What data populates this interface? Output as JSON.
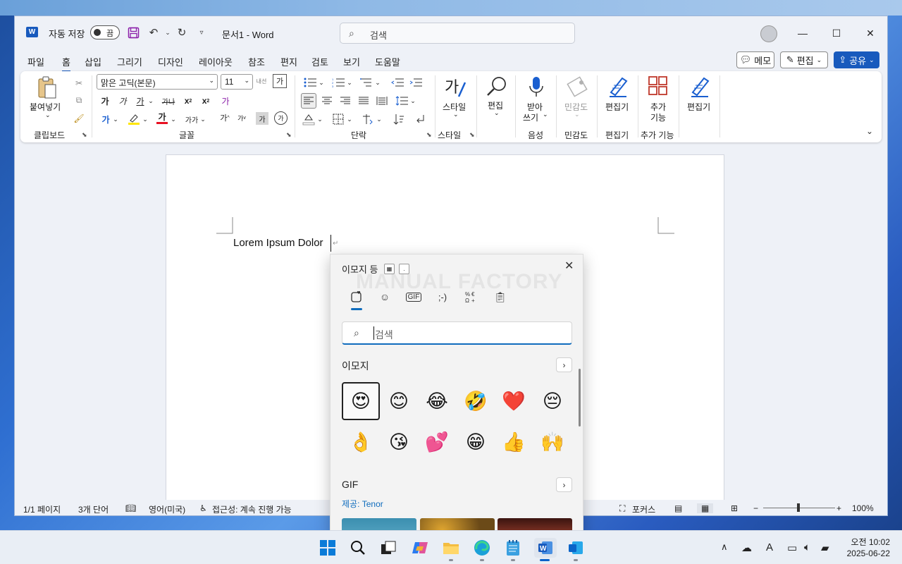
{
  "titlebar": {
    "app_badge": "W",
    "autosave_label": "자동 저장",
    "autosave_state": "끔",
    "doc_title": "문서1  -  Word",
    "search_placeholder": "검색"
  },
  "menu": {
    "tabs": [
      "파일",
      "홈",
      "삽입",
      "그리기",
      "디자인",
      "레이아웃",
      "참조",
      "편지",
      "검토",
      "보기",
      "도움말"
    ],
    "active_tab": "홈",
    "memo_label": "메모",
    "edit_label": "편집",
    "share_label": "공유"
  },
  "ribbon": {
    "clipboard": {
      "paste_label": "붙여넣기",
      "group_label": "클립보드"
    },
    "font": {
      "font_name": "맑은 고딕(본문)",
      "font_size": "11",
      "bold": "가",
      "italic": "가",
      "underline": "가",
      "strike": "가나",
      "sub": "x",
      "sup": "x",
      "grow": "가",
      "shrink": "가",
      "clear": "가",
      "phonetic": "내선",
      "char_border": "가",
      "case": "가가",
      "highlight_char": "가",
      "enclose": "가",
      "font_color": "가",
      "text_effect": "가",
      "group_label": "글꼴"
    },
    "paragraph": {
      "group_label": "단락"
    },
    "styles": {
      "label": "스타일",
      "icon_text": "가",
      "group_label": "스타일"
    },
    "editing": {
      "label": "편집"
    },
    "voice": {
      "label_line1": "받아",
      "label_line2": "쓰기",
      "group_label": "음성"
    },
    "sensitivity": {
      "label": "민감도",
      "group_label": "민감도"
    },
    "editor": {
      "label": "편집기",
      "group_label": "편집기"
    },
    "addins": {
      "label_line1": "추가",
      "label_line2": "기능",
      "group_label": "추가 기능"
    },
    "editor2": {
      "label": "편집기"
    }
  },
  "document": {
    "body_text": "Lorem Ipsum Dolor"
  },
  "statusbar": {
    "page": "1/1 페이지",
    "words": "3개 단어",
    "language": "영어(미국)",
    "accessibility": "접근성: 계속 진행 가능",
    "focus": "포커스",
    "zoom": "100%",
    "zoom_level": 1.0
  },
  "emoji_panel": {
    "title": "이모지 등",
    "watermark": "MANUAL FACTORY",
    "search_placeholder": "검색",
    "section_emoji": "이모지",
    "section_gif": "GIF",
    "provider": "제공: Tenor",
    "categories": [
      "heart-face-icon",
      "smiley-icon",
      "gif-icon",
      "kaomoji-icon",
      "symbols-icon",
      "clipboard-icon"
    ],
    "kaomoji_label": ";-)",
    "gif_label": "GIF",
    "emojis_row1": [
      "😍",
      "😊",
      "😂",
      "🤣",
      "❤️",
      "😔"
    ],
    "emojis_row2": [
      "👌",
      "😘",
      "💕",
      "😁",
      "👍",
      "🙌"
    ]
  },
  "taskbar": {
    "clock_time": "오전 10:02",
    "clock_date": "2025-06-22",
    "ime_indicator": "A"
  },
  "colors": {
    "accent": "#185abd",
    "panel_accent": "#0f6cbd",
    "highlight_yellow": "#ffe600",
    "font_red": "#e81123"
  }
}
